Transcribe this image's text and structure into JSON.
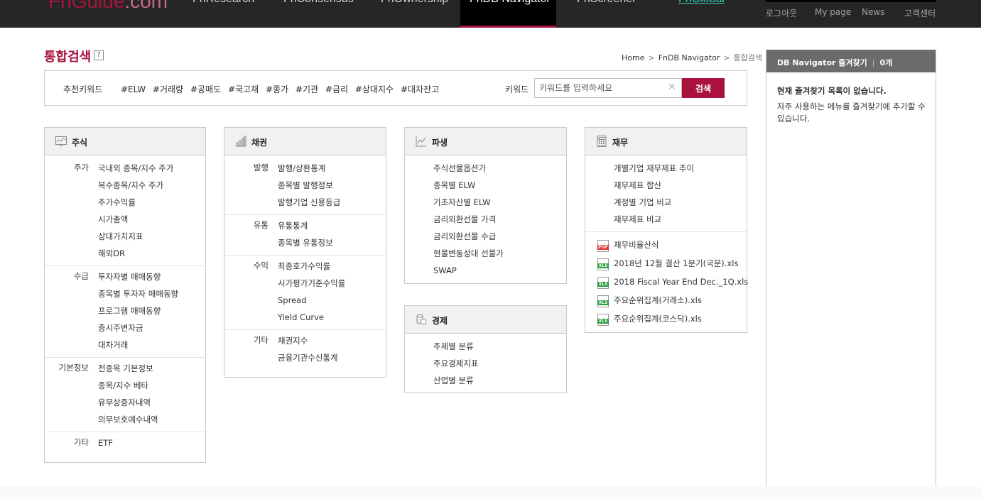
{
  "nav": {
    "logo_fn": "FnGuide",
    "logo_com": ".com",
    "items": [
      {
        "label": "FnResearch"
      },
      {
        "label": "FnConsensus"
      },
      {
        "label": "FnOwnership"
      },
      {
        "label": "FnDB Navigator"
      },
      {
        "label": "FnScreener"
      },
      {
        "label": "FnGlobal"
      }
    ],
    "util": [
      "로그아웃",
      "My page",
      "News",
      "고객센터"
    ]
  },
  "page_title": "통합검색",
  "help_label": "?",
  "breadcrumb": {
    "home": "Home",
    "sep": ">",
    "section": "FnDB Navigator",
    "current": "통합검색"
  },
  "search": {
    "rec_label": "추천키워드",
    "tags": [
      "#ELW",
      "#거래량",
      "#공매도",
      "#국고채",
      "#종가",
      "#기관",
      "#금리",
      "#상대지수",
      "#대차잔고"
    ],
    "kw_label": "키워드",
    "placeholder": "키워드를 입력하세요",
    "clear": "×",
    "button": "검색"
  },
  "panels": {
    "stock": {
      "title": "주식",
      "groups": [
        {
          "label": "주가",
          "items": [
            "국내외 종목/지수 주가",
            "복수종목/지수 주가",
            "주가수익률",
            "시가총액",
            "상대가치지표",
            "해외DR"
          ]
        },
        {
          "label": "수급",
          "items": [
            "투자자별 매매동향",
            "종목별 투자자 매매동향",
            "프로그램 매매동향",
            "증시주변자금",
            "대차거래"
          ]
        },
        {
          "label": "기본정보",
          "items": [
            "전종목 기본정보",
            "종목/지수 베타",
            "유무상증자내역",
            "의무보호예수내역"
          ]
        },
        {
          "label": "기타",
          "items": [
            "ETF"
          ]
        }
      ]
    },
    "bond": {
      "title": "채권",
      "groups": [
        {
          "label": "발행",
          "items": [
            "발행/상환통계",
            "종목별 발행정보",
            "발행기업 신용등급"
          ]
        },
        {
          "label": "유통",
          "items": [
            "유통통계",
            "종목별 유통정보"
          ]
        },
        {
          "label": "수익",
          "items": [
            "최종호가수익률",
            "시가평가기준수익률",
            "Spread",
            "Yield Curve"
          ]
        },
        {
          "label": "기타",
          "items": [
            "채권지수",
            "금융기관수신통계"
          ]
        }
      ]
    },
    "deriv": {
      "title": "파생",
      "items": [
        "주식선물옵션가",
        "종목별 ELW",
        "기초자산별 ELW",
        "금리외환선물 가격",
        "금리외환선물 수급",
        "현물변동성대 선물가",
        "SWAP"
      ]
    },
    "econ": {
      "title": "경제",
      "items": [
        "주제별 분류",
        "주요경제지표",
        "산업별 분류"
      ]
    },
    "fin": {
      "title": "재무",
      "items": [
        "개별기업 재무제표 추이",
        "재무제표 합산",
        "계정별 기업 비교",
        "재무제표 비교"
      ],
      "files": [
        {
          "type": "PDF",
          "label": "재무비율산식"
        },
        {
          "type": "XLS",
          "label": "2018년 12월 결산 1분기(국문).xls"
        },
        {
          "type": "XLS",
          "label": "2018 Fiscal Year End Dec._1Q.xls"
        },
        {
          "type": "XLS",
          "label": "주요순위집계(거래소).xls"
        },
        {
          "type": "XLS",
          "label": "주요순위집계(코스닥).xls"
        }
      ]
    }
  },
  "favorites": {
    "title": "DB Navigator 즐겨찾기",
    "count": "0개",
    "empty": "현재 즐겨찾기 목록이 없습니다.",
    "desc": "자주 사용하는 메뉴를 즐겨찾기에 추가할 수 있습니다."
  }
}
